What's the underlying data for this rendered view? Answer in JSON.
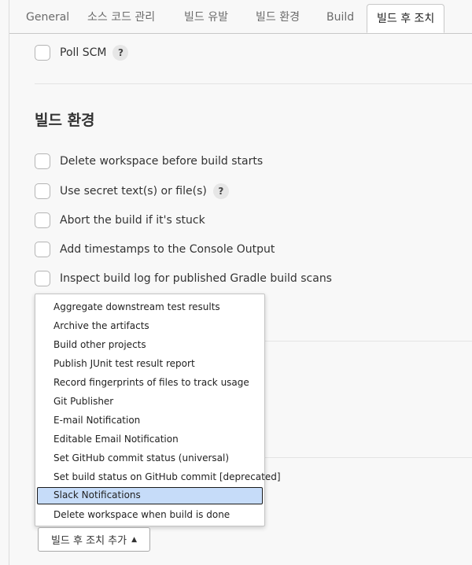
{
  "tabs": [
    {
      "label": "General"
    },
    {
      "label": "소스 코드 관리"
    },
    {
      "label": "빌드 유발"
    },
    {
      "label": "빌드 환경"
    },
    {
      "label": "Build"
    },
    {
      "label": "빌드 후 조치",
      "active": true
    }
  ],
  "build_triggers": {
    "poll_scm": {
      "label": "Poll SCM",
      "checked": false,
      "help": "?"
    }
  },
  "build_env": {
    "title": "빌드 환경",
    "options": [
      {
        "label": "Delete workspace before build starts",
        "checked": false
      },
      {
        "label": "Use secret text(s) or file(s)",
        "checked": false,
        "help": "?"
      },
      {
        "label": "Abort the build if it's stuck",
        "checked": false
      },
      {
        "label": "Add timestamps to the Console Output",
        "checked": false
      },
      {
        "label": "Inspect build log for published Gradle build scans",
        "checked": false
      }
    ]
  },
  "post_build_menu": {
    "items": [
      "Aggregate downstream test results",
      "Archive the artifacts",
      "Build other projects",
      "Publish JUnit test result report",
      "Record fingerprints of files to track usage",
      "Git Publisher",
      "E-mail Notification",
      "Editable Email Notification",
      "Set GitHub commit status (universal)",
      "Set build status on GitHub commit [deprecated]",
      "Slack Notifications",
      "Delete workspace when build is done"
    ],
    "selected_item": "Slack Notifications"
  },
  "add_post_build_button": {
    "label": "빌드 후 조치 추가",
    "icon": "caret-up-icon"
  },
  "colors": {
    "selection": "#c6dcf9",
    "background": "#f8f8f8"
  }
}
